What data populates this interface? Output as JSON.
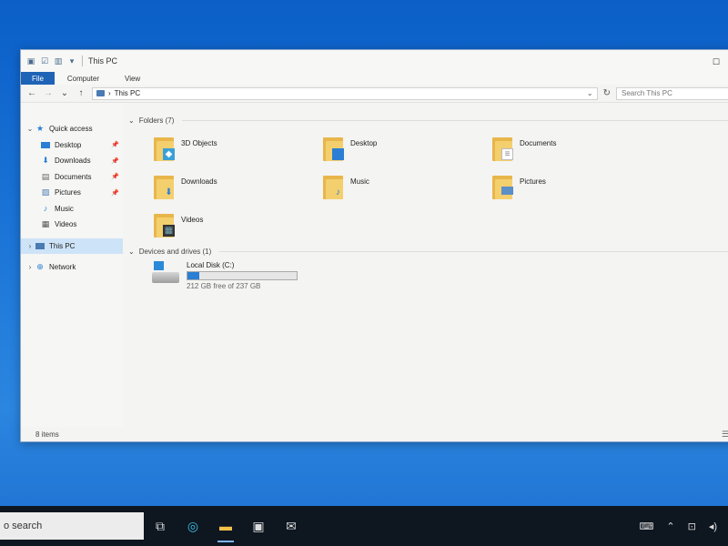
{
  "window": {
    "title": "This PC",
    "ribbon_tabs": [
      "File",
      "Computer",
      "View"
    ],
    "address": "This PC",
    "search_placeholder": "Search This PC"
  },
  "nav_pane": {
    "quick_access": "Quick access",
    "items": [
      {
        "label": "Desktop",
        "icon": "desktop-icon",
        "pinned": true
      },
      {
        "label": "Downloads",
        "icon": "download-icon",
        "pinned": true
      },
      {
        "label": "Documents",
        "icon": "documents-icon",
        "pinned": true
      },
      {
        "label": "Pictures",
        "icon": "pictures-icon",
        "pinned": true
      },
      {
        "label": "Music",
        "icon": "music-icon",
        "pinned": false
      },
      {
        "label": "Videos",
        "icon": "videos-icon",
        "pinned": false
      }
    ],
    "this_pc": "This PC",
    "network": "Network"
  },
  "content": {
    "folders_header": "Folders (7)",
    "folders": [
      {
        "label": "3D Objects",
        "icon": "3d-objects-folder-icon"
      },
      {
        "label": "Desktop",
        "icon": "desktop-folder-icon"
      },
      {
        "label": "Documents",
        "icon": "documents-folder-icon"
      },
      {
        "label": "Downloads",
        "icon": "downloads-folder-icon"
      },
      {
        "label": "Music",
        "icon": "music-folder-icon"
      },
      {
        "label": "Pictures",
        "icon": "pictures-folder-icon"
      },
      {
        "label": "Videos",
        "icon": "videos-folder-icon"
      }
    ],
    "drives_header": "Devices and drives (1)",
    "drive": {
      "name": "Local Disk (C:)",
      "free_text": "212 GB free of 237 GB",
      "used_fraction": 0.105
    }
  },
  "status": {
    "item_count": "8 items"
  },
  "taskbar": {
    "search_text": "o search"
  },
  "colors": {
    "accent": "#1f63b6",
    "selected": "#cde3f7",
    "folder": "#f4cf6e",
    "drive_fill": "#2a7fd4"
  }
}
